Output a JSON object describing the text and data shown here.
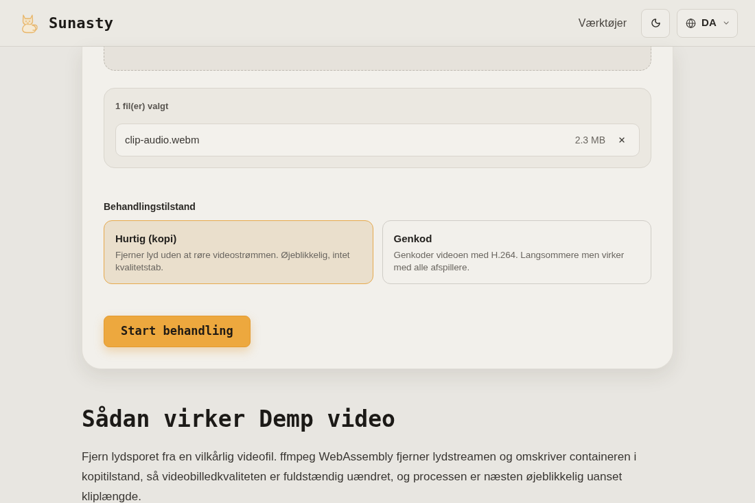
{
  "header": {
    "logo_text": "Sunasty",
    "nav": [
      {
        "label": "Værktøjer"
      }
    ],
    "language": "DA"
  },
  "uploader": {
    "selected_label": "1 fil(er) valgt",
    "files": [
      {
        "name": "clip-audio.webm",
        "size": "2.3 MB"
      }
    ]
  },
  "mode": {
    "label": "Behandlingstilstand",
    "options": [
      {
        "title": "Hurtig (kopi)",
        "description": "Fjerner lyd uden at røre videostrømmen. Øjeblikkelig, intet kvalitetstab.",
        "selected": true
      },
      {
        "title": "Genkod",
        "description": "Genkoder videoen med H.264. Langsommere men virker med alle afspillere.",
        "selected": false
      }
    ]
  },
  "start_button": "Start behandling",
  "article": {
    "heading": "Sådan virker Demp video",
    "paragraph": "Fjern lydsporet fra en vilkårlig videofil. ffmpeg WebAssembly fjerner lydstreamen og omskriver containeren i kopitilstand, så videobilledkvaliteten er fuldstændig uændret, og processen er næsten øjeblikkelig uanset kliplængde."
  }
}
